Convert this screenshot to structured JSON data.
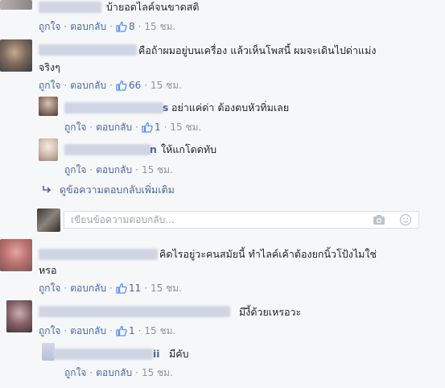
{
  "comments": [
    {
      "text": "บ้ายอดไลค์จนขาดสติ",
      "likes": "8",
      "time": "15 ชม."
    },
    {
      "text_line1": "คือถ้าผมอยู่บนเครื่อง แล้วเห็นโพสนี้ ผมจะเดินไปด่าแม่ง",
      "text_line2": "จริงๆ",
      "likes": "66",
      "time": "15 ชม."
    },
    {
      "text_line1": "คิดไรอยู่วะคนสมัยนี้ ทำไลค์เค้าต้องยกนิ้วโป้งไมใช่",
      "text_line2": "หรอ",
      "likes": "11",
      "time": "15 ชม."
    },
    {
      "text": "มึงี้ด้วยเหรอวะ",
      "likes": "1",
      "time": "15 ชม."
    },
    {
      "text": "มีคับ",
      "name_tail": "ii",
      "time": "15 ชม."
    }
  ],
  "replies": [
    {
      "text": "อย่าแค่ด่า ต้องตบหัวทิ่มเลย",
      "name_tail": "s",
      "likes": "1",
      "time": "15 ชม."
    },
    {
      "text": "ให้แกโดดทับ",
      "name_tail": "n",
      "time": "15 ชม."
    }
  ],
  "labels": {
    "like": "ถูกใจ",
    "reply": "ตอบกลับ",
    "separator": "·",
    "more_replies": "ดูข้อความตอบกลับเพิ่มเติม",
    "reply_placeholder": "เขียนข้อความตอบกลับ..."
  },
  "colors": {
    "link": "#4b67a1",
    "meta": "#90949c",
    "text": "#1d2129"
  }
}
